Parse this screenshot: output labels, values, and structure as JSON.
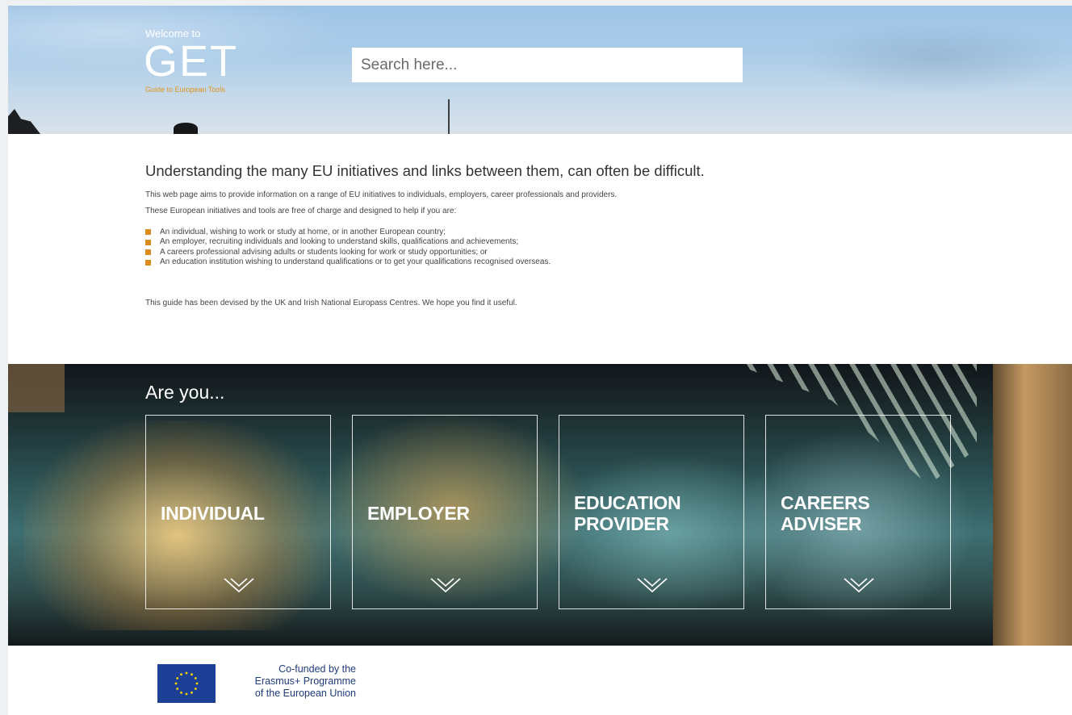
{
  "header": {
    "welcome": "Welcome to",
    "logo": "GET",
    "logo_subtitle": "Guide to European Tools",
    "search_placeholder": "Search here..."
  },
  "intro": {
    "heading": "Understanding the many EU initiatives and links between them, can often be difficult.",
    "paragraph1": "This web page aims to provide information on a range of EU initiatives to individuals, employers, career professionals and providers.",
    "paragraph2": "These European initiatives and tools are free of charge and designed to help if you are:",
    "bullets": [
      "An individual, wishing to work or study at home, or in another European country;",
      "An employer, recruiting individuals and looking to understand skills, qualifications and achievements;",
      "A careers professional advising adults or students looking for work or study opportunities; or",
      "An education institution wishing to understand qualifications or to get your qualifications recognised overseas."
    ],
    "closing": "This guide has been devised by the UK and Irish National Europass Centres. We hope you find it useful.",
    "bullet_color": "#d98b1c"
  },
  "audience": {
    "heading": "Are you...",
    "cards": [
      {
        "line1": "INDIVIDUAL",
        "line2": ""
      },
      {
        "line1": "EMPLOYER",
        "line2": ""
      },
      {
        "line1": "EDUCATION",
        "line2": "PROVIDER"
      },
      {
        "line1": "CAREERS",
        "line2": "ADVISER"
      }
    ],
    "expand_icon": "chevron-down-icon"
  },
  "footer": {
    "line1": "Co-funded by the",
    "line2": "Erasmus+ Programme",
    "line3": "of the European Union",
    "eu_flag_color": "#1d3f95",
    "eu_star_color": "#ffdd00"
  }
}
